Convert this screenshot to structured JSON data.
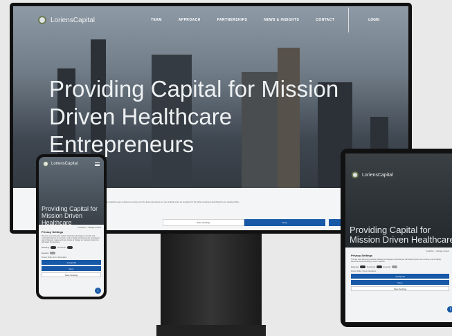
{
  "brand": {
    "name": "LoriensCapital"
  },
  "desktop": {
    "nav": [
      "TEAM",
      "APPROACH",
      "PARTNERSHIPS",
      "NEWS & INSIGHTS",
      "CONTACT"
    ],
    "login": "LOGIN",
    "hero_title": "Providing Capital for Mission Driven Healthcare Entrepreneurs",
    "cookie_text": "This website uses cookies to ensure you the best experience on our website and, as needed, for the other purposes described in our cookie policy.",
    "btn_settings": "Save Settings",
    "btn_deny": "Deny"
  },
  "phone": {
    "hero_title": "Providing Capital for Mission Driven Healthcare",
    "powered": "Cookiebot — Manage consent",
    "privacy_title": "Privacy Settings",
    "privacy_text": "This site uses third-party website tracking technologies to provide and continually improve our services, and to display advertisements according to users' interests. I agree and may revoke or change my consent at any time with effect for the future.",
    "toggles": [
      "Marketing",
      "Functional",
      "Essential"
    ],
    "links": "Privacy Policy   Terms Information",
    "btn_accept": "Accept All",
    "btn_deny": "Deny",
    "btn_save": "Save Settings",
    "info": "i"
  },
  "tablet": {
    "hero_title": "Providing Capital for Mission Driven Healthcare",
    "powered": "Cookiebot — Manage consent",
    "privacy_title": "Privacy Settings",
    "privacy_text": "This site uses third-party website tracking technologies to provide and continually improve our services, and to display advertisements according to users' interests.",
    "toggles": [
      "Marketing",
      "Functional",
      "Essential"
    ],
    "links": "Privacy Policy   Terms Information",
    "btn_accept": "Accept All",
    "btn_deny": "Deny",
    "btn_save": "Save Settings",
    "info": "i"
  }
}
